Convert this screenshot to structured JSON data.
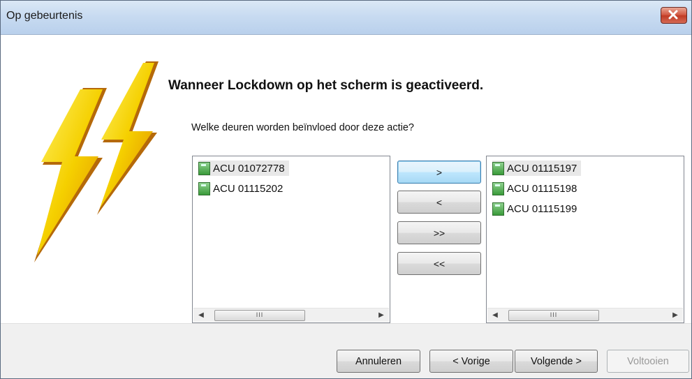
{
  "window": {
    "title": "Op gebeurtenis",
    "close_icon": "close-icon"
  },
  "main": {
    "heading": "Wanneer Lockdown op het scherm is geactiveerd.",
    "question": "Welke deuren worden beïnvloed door deze actie?",
    "illustration_icon": "lightning-bolt-icon"
  },
  "available_list": {
    "items": [
      "ACU 01072778",
      "ACU 01115202"
    ],
    "selected_index": 0,
    "scroll_thumb_label": "III"
  },
  "selected_list": {
    "items": [
      "ACU 01115197",
      "ACU 01115198",
      "ACU 01115199"
    ],
    "selected_index": 0,
    "scroll_thumb_label": "III"
  },
  "move_buttons": {
    "add": ">",
    "remove": "<",
    "add_all": ">>",
    "remove_all": "<<"
  },
  "footer": {
    "cancel": "Annuleren",
    "previous": "< Vorige",
    "next": "Volgende >",
    "finish": "Voltooien"
  },
  "colors": {
    "titlebar": "#c8dbf1",
    "close_button": "#c03a24",
    "bolt_yellow": "#f5d000",
    "device_icon": "#3a9a3a"
  }
}
